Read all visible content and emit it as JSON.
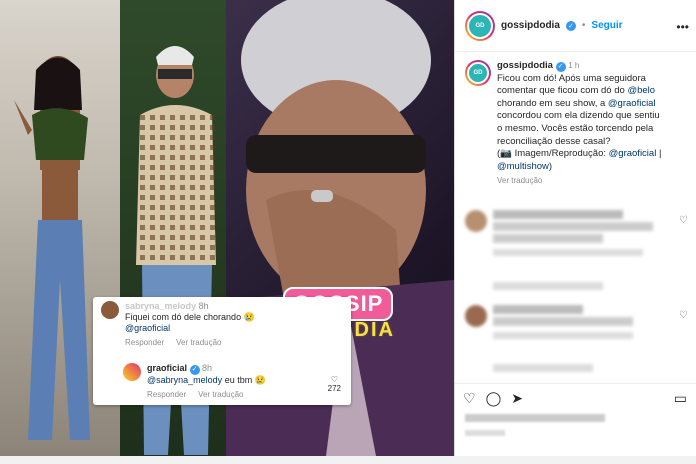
{
  "post": {
    "username": "gossipdodia",
    "follow_label": "Seguir",
    "time": "1 h",
    "caption_lines": [
      "Ficou com dó! Após uma seguidora",
      "comentar que ficou com dó do",
      "chorando em seu show, a",
      "concordou com ela dizendo que sentiu",
      "o mesmo. Vocês estão torcendo pela",
      "reconciliação desse casal?",
      "(📷 Imagem/Reprodução:"
    ],
    "mention_belo": "@belo",
    "mention_grao": "@graoficial",
    "mention_multishow": "@multishow",
    "separator": "|",
    "close_paren": ")",
    "see_translation": "Ver tradução",
    "logo_text": "GOSSIP DO DIA"
  },
  "overlay": {
    "comment1_user": "sabryna_melody",
    "comment1_time": "8h",
    "comment1_text": "Fiquei com dó dele chorando 😢",
    "comment1_mention": "@graoficial",
    "reply_label": "Responder",
    "translate_label": "Ver tradução",
    "comment2_user": "graoficial",
    "comment2_time": "8h",
    "comment2_mention": "@sabryna_melody",
    "comment2_text": "eu tbm 😢",
    "likes": "272"
  },
  "logo_overlay": {
    "line1": "GOSSIP",
    "line2": "DO DIA"
  },
  "icons": [
    "more-icon",
    "verified-icon",
    "heart-icon",
    "comment-icon",
    "share-icon",
    "save-icon"
  ],
  "colors": {
    "accent": "#0095f6",
    "link": "#00376b",
    "brand_pink": "#f25b9a",
    "brand_yellow": "#f4e04d"
  }
}
